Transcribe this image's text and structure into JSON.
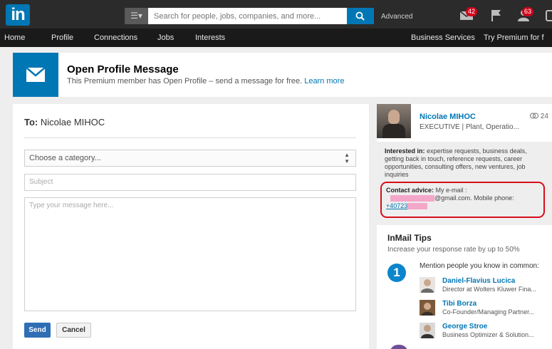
{
  "topbar": {
    "logo": "in",
    "search_placeholder": "Search for people, jobs, companies, and more...",
    "advanced": "Advanced",
    "messages_badge": "42",
    "notifications_badge": "63"
  },
  "nav": {
    "items": [
      "Home",
      "Profile",
      "Connections",
      "Jobs",
      "Interests"
    ],
    "business_services": "Business Services",
    "premium": "Try Premium for f"
  },
  "banner": {
    "title": "Open Profile Message",
    "subtitle": "This Premium member has Open Profile – send a message for free.",
    "learn_more": "Learn more"
  },
  "compose": {
    "to_label": "To:",
    "to_name": "Nicolae MIHOC",
    "category_placeholder": "Choose a category...",
    "subject_placeholder": "Subject",
    "message_placeholder": "Type your message here...",
    "send": "Send",
    "cancel": "Cancel"
  },
  "profile": {
    "name": "Nicolae MIHOC",
    "title": "EXECUTIVE | Plant, Operatio...",
    "connections": "24",
    "interested_label": "Interested in:",
    "interested_text": "expertise requests, business deals, getting back in touch, reference requests, career opportunities, consulting offers, new ventures, job inquiries",
    "contact_label": "Contact advice:",
    "contact_text": "My e-mail :",
    "email_suffix": "@gmail.com. Mobile phone:",
    "phone_prefix": "+40723"
  },
  "tips": {
    "title": "InMail Tips",
    "subtitle": "Increase your response rate by up to 50%",
    "number": "1",
    "tip_text": "Mention people you know in common:",
    "people": [
      {
        "name": "Daniel-Flavius Lucica",
        "title": "Director at Wolters Kluwer Fina..."
      },
      {
        "name": "Tibi Borza",
        "title": "Co-Founder/Managing Partner..."
      },
      {
        "name": "George Stroe",
        "title": "Business Optimizer & Solution..."
      }
    ]
  },
  "colors": {
    "brand": "#0077b5",
    "topbar": "#2b2b2b",
    "highlight_border": "#d60e1a",
    "redaction": "#f4a7c9"
  }
}
